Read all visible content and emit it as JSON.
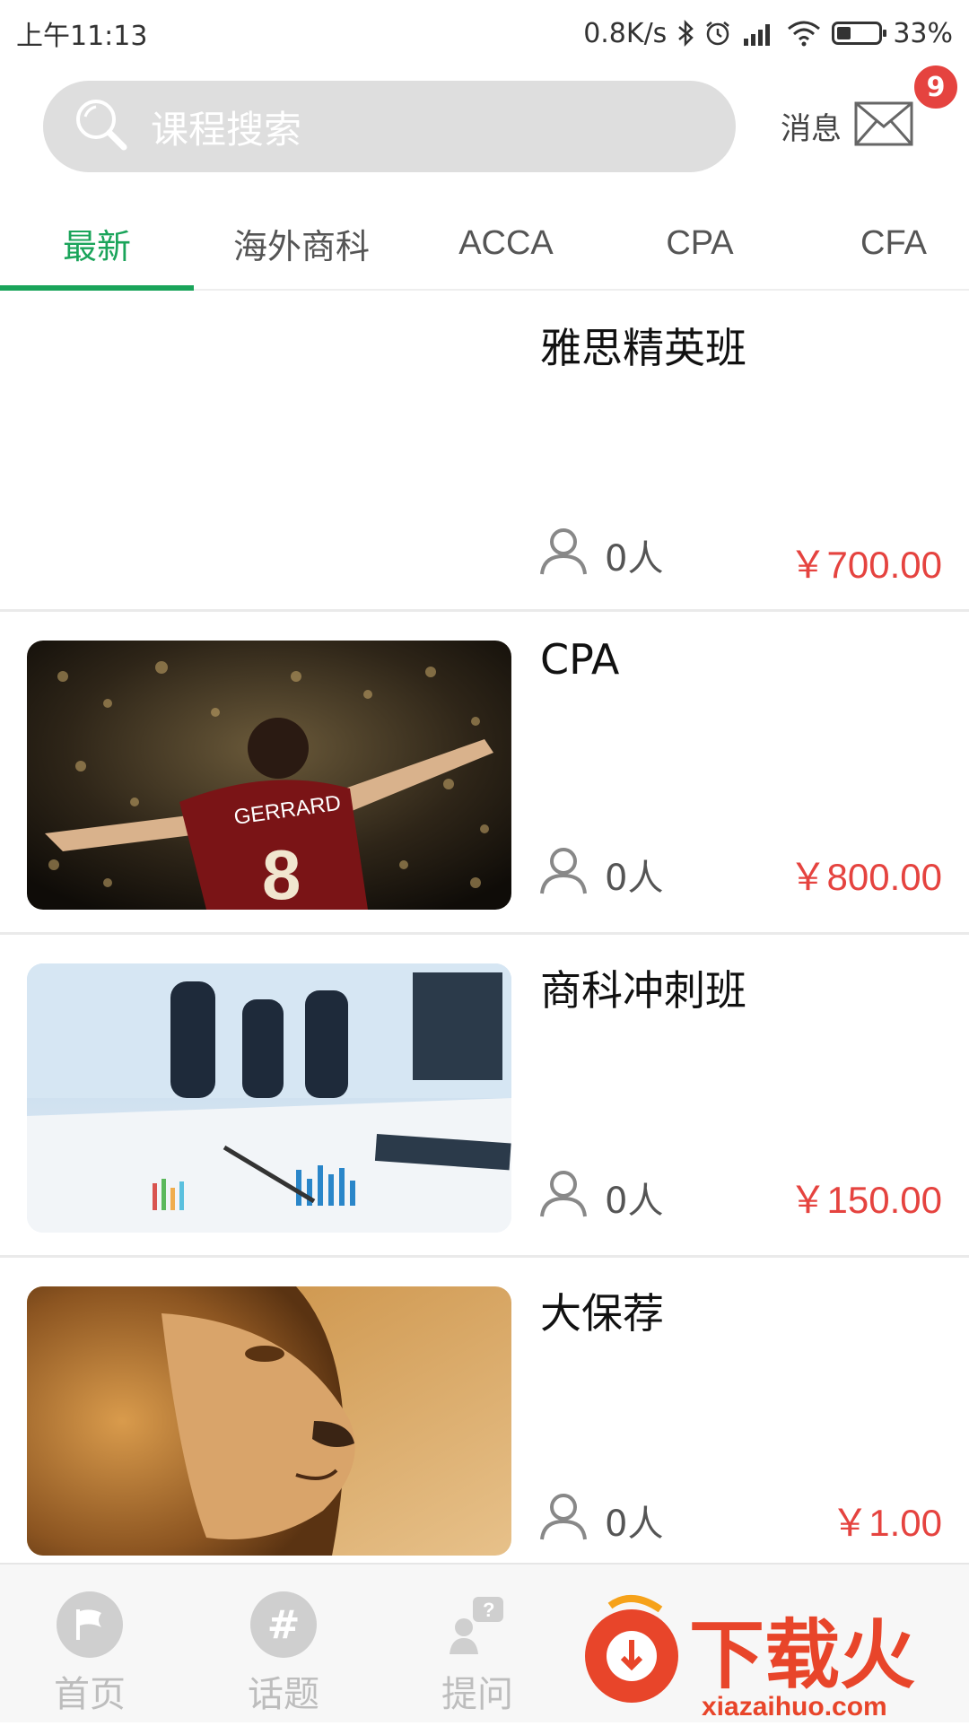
{
  "status_bar": {
    "time": "上午11:13",
    "network_speed": "0.8K/s",
    "battery": "33%",
    "battery_level": 0.33,
    "icons": [
      "bluetooth-icon",
      "alarm-icon",
      "signal-icon",
      "wifi-icon",
      "battery-icon"
    ]
  },
  "header": {
    "search_placeholder": "课程搜索",
    "messages_label": "消息",
    "messages_badge": "9"
  },
  "tabs": [
    {
      "label": "最新",
      "active": true
    },
    {
      "label": "海外商科",
      "active": false
    },
    {
      "label": "ACCA",
      "active": false
    },
    {
      "label": "CPA",
      "active": false
    },
    {
      "label": "CFA",
      "active": false
    }
  ],
  "courses": [
    {
      "title": "雅思精英班",
      "count": "0人",
      "price": "￥700.00",
      "image": "none"
    },
    {
      "title": "CPA",
      "count": "0人",
      "price": "￥800.00",
      "image": "football-player"
    },
    {
      "title": "商科冲刺班",
      "count": "0人",
      "price": "￥150.00",
      "image": "business-meeting"
    },
    {
      "title": "大保荐",
      "count": "0人",
      "price": "￥1.00",
      "image": "lion"
    }
  ],
  "bottom_nav": [
    {
      "label": "首页",
      "icon": "flag-icon"
    },
    {
      "label": "话题",
      "icon": "hash-icon"
    },
    {
      "label": "提问",
      "icon": "ask-icon"
    }
  ],
  "watermark": {
    "text": "下载火",
    "url_text": "xiazaihuo.com"
  },
  "colors": {
    "accent": "#1aa45a",
    "price": "#e5433f",
    "badge": "#e5433f"
  }
}
